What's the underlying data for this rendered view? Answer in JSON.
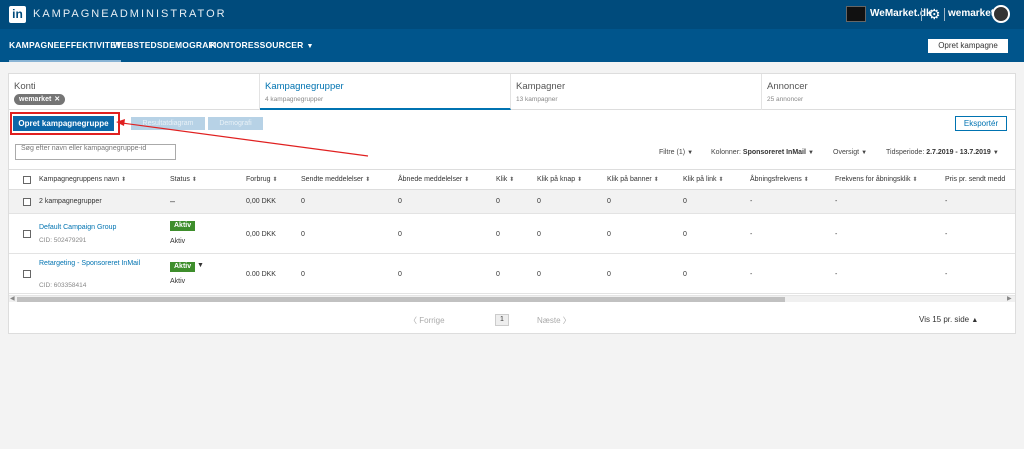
{
  "topbar": {
    "logo": "in",
    "app_title": "KAMPAGNEADMINISTRATOR",
    "account_name": "WeMarket.dk",
    "user_name": "wemarket"
  },
  "nav": {
    "items": [
      {
        "label": "KAMPAGNEEFFEKTIVITET",
        "active": true
      },
      {
        "label": "WEBSTEDSDEMOGRAFI",
        "active": false
      },
      {
        "label": "KONTORESSOURCER",
        "active": false
      }
    ],
    "create_campaign": "Opret kampagne"
  },
  "tabs": {
    "accounts": {
      "title": "Konti",
      "chip": "wemarket"
    },
    "groups": {
      "title": "Kampagnegrupper",
      "sub": "4 kampagnegrupper"
    },
    "campaigns": {
      "title": "Kampagner",
      "sub": "13 kampagner"
    },
    "ads": {
      "title": "Annoncer",
      "sub": "25 annoncer"
    }
  },
  "toolbar": {
    "create_group": "Opret kampagnegruppe",
    "results_chart": "Resultatdiagram",
    "demographics": "Demografi",
    "export": "Eksportér"
  },
  "search": {
    "placeholder": "Søg efter navn eller kampagnegruppe-id"
  },
  "filters": {
    "filter": "Filtre (1)",
    "columns_label": "Kolonner:",
    "columns_value": "Sponsoreret InMail",
    "overview": "Oversigt",
    "period_label": "Tidsperiode:",
    "period_value": "2.7.2019 - 13.7.2019"
  },
  "table": {
    "headers": [
      "Kampagnegruppens navn",
      "Status",
      "Forbrug",
      "Sendte meddelelser",
      "Åbnede meddelelser",
      "Klik",
      "Klik på knap",
      "Klik på banner",
      "Klik på link",
      "Åbningsfrekvens",
      "Frekvens for åbningsklik",
      "Pris pr. sendt medd"
    ],
    "summary": {
      "name": "2 kampagnegrupper",
      "status": "–",
      "spend": "0,00 DKK",
      "sent": "0",
      "opened": "0",
      "clicks": "0",
      "btn": "0",
      "banner": "0",
      "link": "0",
      "open_rate": "-",
      "open_click": "-",
      "price": "-"
    },
    "rows": [
      {
        "name": "Default Campaign Group",
        "cid": "CID: 502479291",
        "badge": "Aktiv",
        "status": "Aktiv",
        "spend": "0,00 DKK",
        "sent": "0",
        "opened": "0",
        "clicks": "0",
        "btn": "0",
        "banner": "0",
        "link": "0",
        "open_rate": "-",
        "open_click": "-",
        "price": "-"
      },
      {
        "name": "Retargeting - Sponsoreret InMail",
        "cid": "CID: 603358414",
        "badge": "Aktiv",
        "status": "Aktiv",
        "spend": "0.00 DKK",
        "sent": "0",
        "opened": "0",
        "clicks": "0",
        "btn": "0",
        "banner": "0",
        "link": "0",
        "open_rate": "-",
        "open_click": "-",
        "price": "-"
      }
    ]
  },
  "pager": {
    "prev": "Forrige",
    "page": "1",
    "next": "Næste",
    "per_page": "Vis 15 pr. side"
  },
  "colors": {
    "topbar": "#004b7c",
    "navbar": "#00558c",
    "primary": "#0b67a8",
    "active_badge": "#3e8e2c",
    "annotation": "#e02020"
  }
}
